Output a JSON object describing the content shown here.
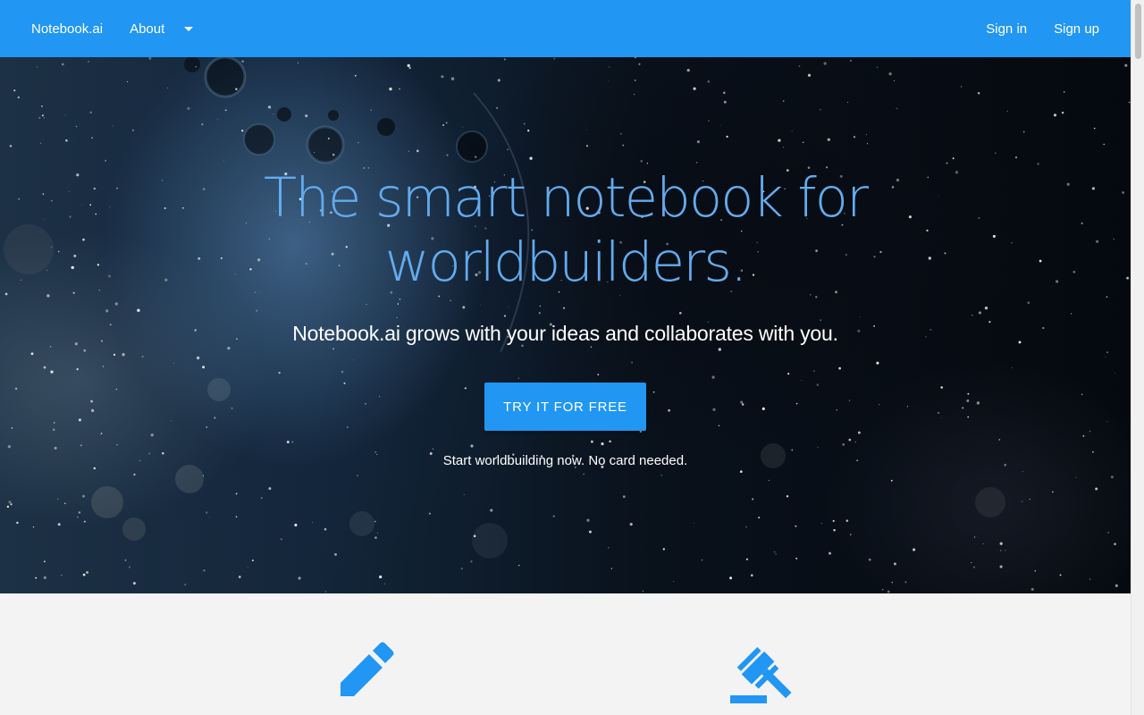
{
  "nav": {
    "brand": "Notebook.ai",
    "about": "About",
    "sign_in": "Sign in",
    "sign_up": "Sign up"
  },
  "hero": {
    "headline_line1": "The smart notebook for",
    "headline_line2": "worldbuilders.",
    "subheading": "Notebook.ai grows with your ideas and collaborates with you.",
    "cta_label": "TRY IT FOR FREE",
    "note": "Start worldbuilding now. No card needed."
  },
  "features": {
    "icons": [
      "pencil-icon",
      "gavel-icon"
    ]
  },
  "colors": {
    "brand_blue": "#2196f3",
    "headline_blue": "#63abee",
    "section_background": "#f3f3f3"
  }
}
